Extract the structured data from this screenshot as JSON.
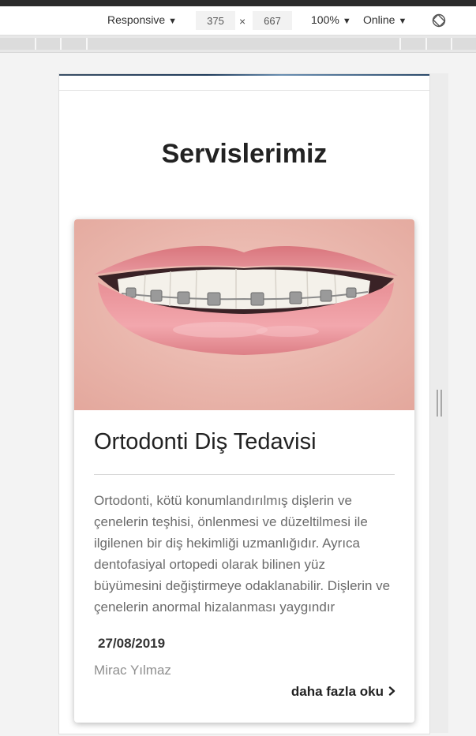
{
  "devtools": {
    "device": "Responsive",
    "width_value": "375",
    "times_symbol": "×",
    "height_value": "667",
    "zoom": "100%",
    "network": "Online",
    "caret": "▼",
    "rotate_icon": "rotate-icon"
  },
  "page": {
    "section_title": "Servislerimiz"
  },
  "card": {
    "image_icon": "braces-smile-photo",
    "title": "Ortodonti Diş Tedavisi",
    "description": "Ortodonti, kötü konumlandırılmış dişlerin ve çenelerin teşhisi, önlenmesi ve düzeltilmesi ile ilgilenen bir diş hekimliği uzmanlığıdır. Ayrıca dentofasiyal ortopedi olarak bilinen yüz büyümesini değiştirmeye odaklanabilir. Dişlerin ve çenelerin anormal hizalanması yaygındır",
    "date": "27/08/2019",
    "author": "Mirac Yılmaz",
    "read_more": "daha fazla oku",
    "read_more_icon": "chevron-right-icon"
  }
}
